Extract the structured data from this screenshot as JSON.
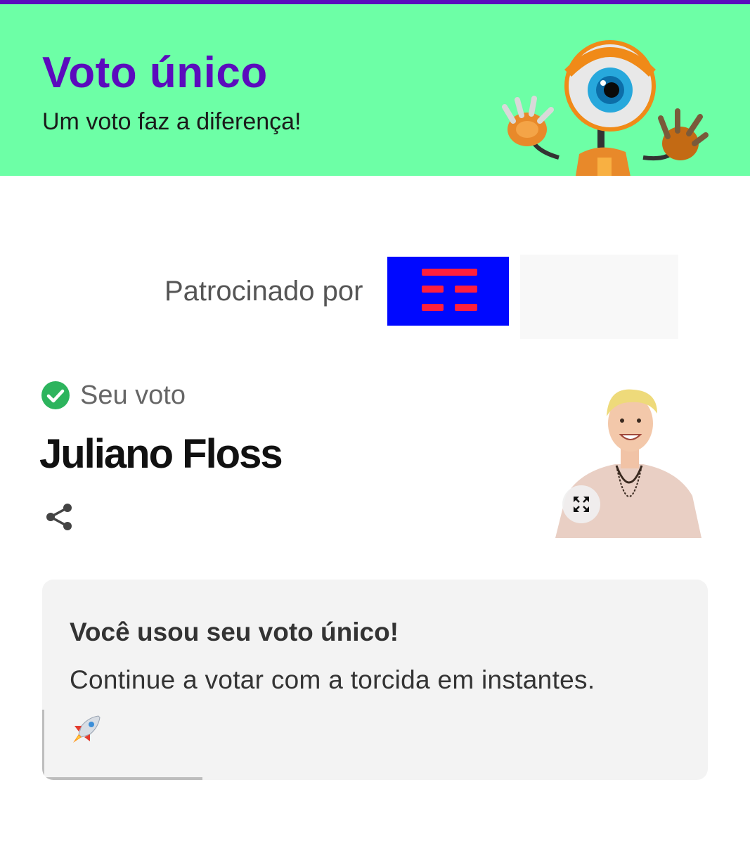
{
  "header": {
    "title": "Voto único",
    "subtitle": "Um voto faz a diferença!",
    "mascot_icon": "big-brother-eye-mascot"
  },
  "sponsor": {
    "label": "Patrocinado por",
    "logo_icon": "sponsor-logo"
  },
  "vote": {
    "status_label": "Seu voto",
    "status_icon": "check-circle-icon",
    "candidate_name": "Juliano Floss",
    "share_icon": "share-icon",
    "expand_icon": "expand-icon"
  },
  "card": {
    "title": "Você usou seu voto único!",
    "text": "Continue a votar com a torcida em instantes.",
    "emoji_icon": "rocket-icon"
  },
  "colors": {
    "accent_purple": "#5b0bbd",
    "header_green": "#6dffa6",
    "check_green": "#2db45d",
    "sponsor_blue": "#0008ff",
    "sponsor_red": "#ff1e3c"
  }
}
